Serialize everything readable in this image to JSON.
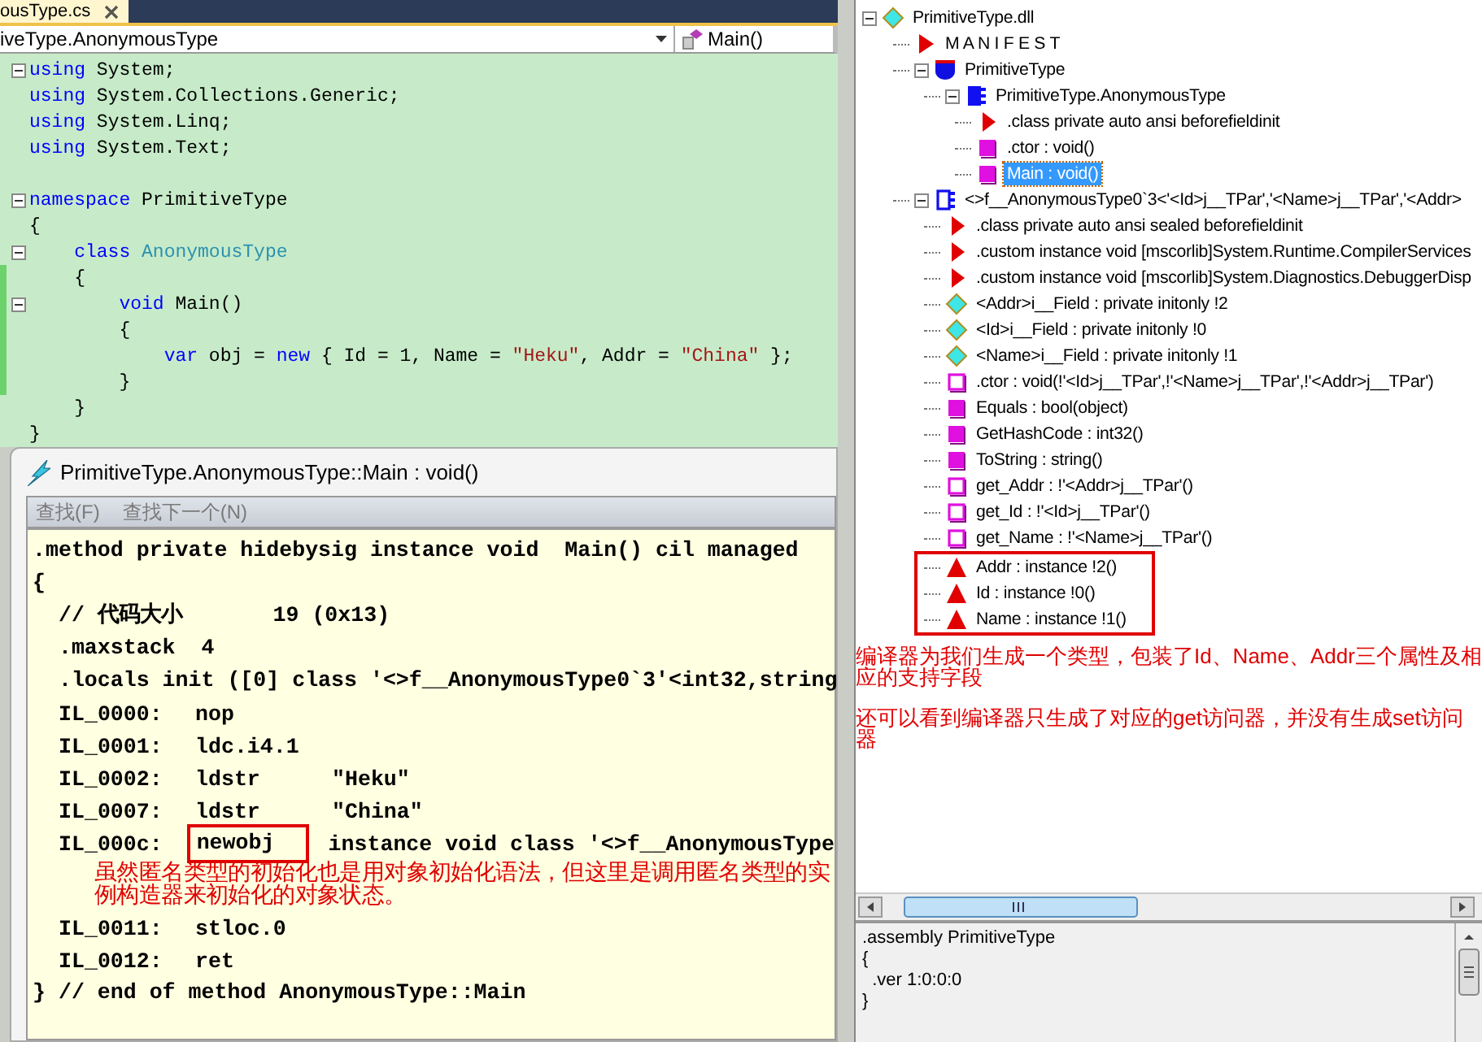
{
  "editor": {
    "tab": {
      "title": "ousType.cs"
    },
    "class_dropdown": "iveType.AnonymousType",
    "member_dropdown": "Main()"
  },
  "code_lines": [
    {
      "fold": true,
      "changed": false,
      "segments": [
        {
          "kind": "keyword",
          "text": "using"
        },
        {
          "kind": "plain",
          "text": " System;"
        }
      ]
    },
    {
      "fold": false,
      "changed": false,
      "segments": [
        {
          "kind": "keyword",
          "text": "using"
        },
        {
          "kind": "plain",
          "text": " System.Collections.Generic;"
        }
      ]
    },
    {
      "fold": false,
      "changed": false,
      "segments": [
        {
          "kind": "keyword",
          "text": "using"
        },
        {
          "kind": "plain",
          "text": " System.Linq;"
        }
      ]
    },
    {
      "fold": false,
      "changed": false,
      "segments": [
        {
          "kind": "keyword",
          "text": "using"
        },
        {
          "kind": "plain",
          "text": " System.Text;"
        }
      ]
    },
    {
      "fold": false,
      "changed": false
    },
    {
      "fold": true,
      "changed": false,
      "segments": [
        {
          "kind": "keyword",
          "text": "namespace"
        },
        {
          "kind": "plain",
          "text": " PrimitiveType"
        }
      ]
    },
    {
      "fold": false,
      "changed": false,
      "segments": [
        {
          "kind": "plain",
          "text": "{"
        }
      ]
    },
    {
      "fold": true,
      "changed": false,
      "segments": [
        {
          "kind": "keyword",
          "text": "    class"
        },
        {
          "kind": "type",
          "text": " AnonymousType"
        }
      ]
    },
    {
      "fold": false,
      "changed": true,
      "segments": [
        {
          "kind": "plain",
          "text": "    {"
        }
      ]
    },
    {
      "fold": true,
      "changed": true,
      "segments": [
        {
          "kind": "keyword",
          "text": "        void"
        },
        {
          "kind": "plain",
          "text": " Main()"
        }
      ]
    },
    {
      "fold": false,
      "changed": true,
      "segments": [
        {
          "kind": "plain",
          "text": "        {"
        }
      ]
    },
    {
      "fold": false,
      "changed": true,
      "segments": [
        {
          "kind": "keyword",
          "text": "            var"
        },
        {
          "kind": "plain",
          "text": " obj = "
        },
        {
          "kind": "keyword",
          "text": "new"
        },
        {
          "kind": "plain",
          "text": " { Id = 1, Name = "
        },
        {
          "kind": "string",
          "text": "\"Heku\""
        },
        {
          "kind": "plain",
          "text": ", Addr = "
        },
        {
          "kind": "string",
          "text": "\"China\""
        },
        {
          "kind": "plain",
          "text": " };"
        }
      ]
    },
    {
      "fold": false,
      "changed": true,
      "segments": [
        {
          "kind": "plain",
          "text": "        }"
        }
      ]
    },
    {
      "fold": false,
      "changed": false,
      "segments": [
        {
          "kind": "plain",
          "text": "    }"
        }
      ]
    },
    {
      "fold": false,
      "changed": false,
      "segments": [
        {
          "kind": "plain",
          "text": "}"
        }
      ]
    }
  ],
  "il_window": {
    "title": "PrimitiveType.AnonymousType::Main : void()",
    "menu": [
      "查找(F)",
      "查找下一个(N)"
    ]
  },
  "il_lines": [
    {
      "kind": "text",
      "text": ".method private hidebysig instance void  Main() cil managed"
    },
    {
      "kind": "text",
      "text": "{"
    },
    {
      "kind": "text",
      "text": "  // 代码大小       19 (0x13)"
    },
    {
      "kind": "text",
      "text": "  .maxstack  4"
    },
    {
      "kind": "text",
      "text": "  .locals init ([0] class '<>f__AnonymousType0`3'<int32,string"
    },
    {
      "kind": "instr",
      "label": "IL_0000:",
      "opcode": "nop",
      "highlighted": false
    },
    {
      "kind": "instr",
      "label": "IL_0001:",
      "opcode": "ldc.i4.1",
      "highlighted": false
    },
    {
      "kind": "instr",
      "label": "IL_0002:",
      "opcode": "ldstr",
      "operand": "\"Heku\"",
      "highlighted": false
    },
    {
      "kind": "instr",
      "label": "IL_0007:",
      "opcode": "ldstr",
      "operand": "\"China\"",
      "highlighted": false
    },
    {
      "kind": "instr",
      "label": "IL_000c:",
      "opcode": "newobj",
      "operand": "instance void class '<>f__AnonymousType",
      "highlighted": true
    },
    {
      "kind": "note",
      "text": "虽然匿名类型的初始化也是用对象初始化语法，但这里是调用匿名类型的实例构造器来初始化的对象状态。"
    },
    {
      "kind": "instr",
      "label": "IL_0011:",
      "opcode": "stloc.0",
      "highlighted": false
    },
    {
      "kind": "instr",
      "label": "IL_0012:",
      "opcode": "ret",
      "highlighted": false
    },
    {
      "kind": "text",
      "text": "} // end of method AnonymousType::Main"
    }
  ],
  "tree": {
    "kind": "assembly",
    "label": "PrimitiveType.dll",
    "selected": false,
    "highlighted": false,
    "expanded": true,
    "children": [
      {
        "kind": "manifest",
        "label": "M A N I F E S T",
        "selected": false,
        "highlighted": false
      },
      {
        "kind": "namespace",
        "label": "PrimitiveType",
        "selected": false,
        "highlighted": false,
        "expanded": true,
        "children": [
          {
            "kind": "class",
            "label": "PrimitiveType.AnonymousType",
            "selected": false,
            "highlighted": false,
            "expanded": true,
            "children": [
              {
                "kind": "directive",
                "label": ".class private auto ansi beforefieldinit",
                "selected": false,
                "highlighted": false
              },
              {
                "kind": "method",
                "label": ".ctor : void()",
                "selected": false,
                "highlighted": false
              },
              {
                "kind": "method",
                "label": "Main : void()",
                "selected": true,
                "highlighted": false
              }
            ]
          }
        ]
      },
      {
        "kind": "generic-class",
        "label": "<>f__AnonymousType0`3<'<Id>j__TPar','<Name>j__TPar','<Addr>",
        "selected": false,
        "highlighted": false,
        "expanded": true,
        "children": [
          {
            "kind": "directive",
            "label": ".class private auto ansi sealed beforefieldinit",
            "selected": false,
            "highlighted": false
          },
          {
            "kind": "directive",
            "label": ".custom instance void [mscorlib]System.Runtime.CompilerServices",
            "selected": false,
            "highlighted": false
          },
          {
            "kind": "directive",
            "label": ".custom instance void [mscorlib]System.Diagnostics.DebuggerDisp",
            "selected": false,
            "highlighted": false
          },
          {
            "kind": "field",
            "label": "<Addr>i__Field : private initonly !2",
            "selected": false,
            "highlighted": false
          },
          {
            "kind": "field",
            "label": "<Id>i__Field : private initonly !0",
            "selected": false,
            "highlighted": false
          },
          {
            "kind": "field",
            "label": "<Name>i__Field : private initonly !1",
            "selected": false,
            "highlighted": false
          },
          {
            "kind": "instance-method",
            "label": ".ctor : void(!'<Id>j__TPar',!'<Name>j__TPar',!'<Addr>j__TPar')",
            "selected": false,
            "highlighted": false
          },
          {
            "kind": "method",
            "label": "Equals : bool(object)",
            "selected": false,
            "highlighted": false
          },
          {
            "kind": "method",
            "label": "GetHashCode : int32()",
            "selected": false,
            "highlighted": false
          },
          {
            "kind": "method",
            "label": "ToString : string()",
            "selected": false,
            "highlighted": false
          },
          {
            "kind": "instance-method",
            "label": "get_Addr : !'<Addr>j__TPar'()",
            "selected": false,
            "highlighted": false
          },
          {
            "kind": "instance-method",
            "label": "get_Id : !'<Id>j__TPar'()",
            "selected": false,
            "highlighted": false
          },
          {
            "kind": "instance-method",
            "label": "get_Name : !'<Name>j__TPar'()",
            "selected": false,
            "highlighted": false
          },
          {
            "kind": "property",
            "label": "Addr : instance !2()",
            "selected": false,
            "highlighted": true
          },
          {
            "kind": "property",
            "label": "Id : instance !0()",
            "selected": false,
            "highlighted": true
          },
          {
            "kind": "property",
            "label": "Name : instance !1()",
            "selected": false,
            "highlighted": true
          }
        ]
      }
    ]
  },
  "notes": [
    "编译器为我们生成一个类型，包装了Id、Name、Addr三个属性及相应的支持字段",
    "还可以看到编译器只生成了对应的get访问器，并没有生成set访问器"
  ],
  "info_pane": [
    ".assembly PrimitiveType",
    "{",
    "  .ver 1:0:0:0",
    "}"
  ]
}
